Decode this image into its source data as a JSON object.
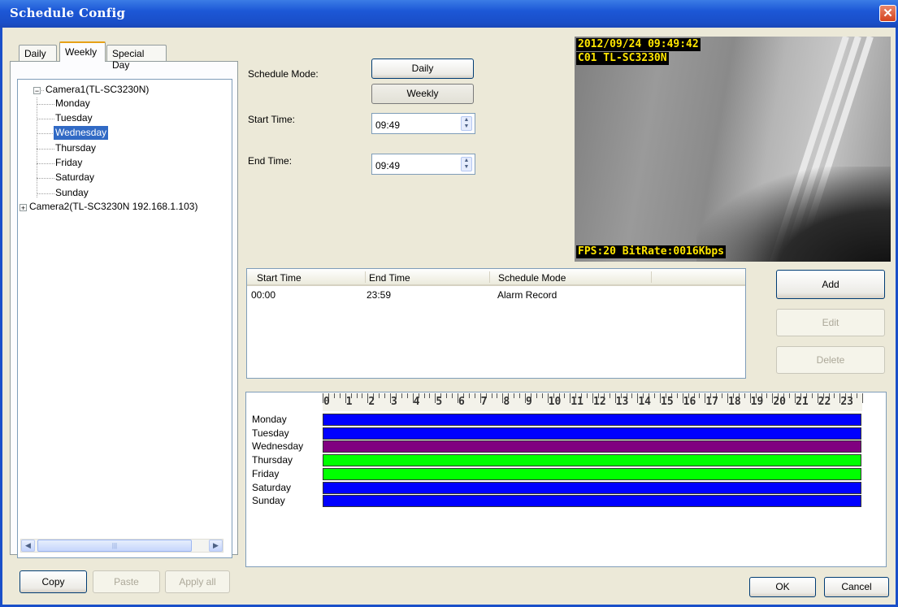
{
  "window": {
    "title": "Schedule Config",
    "close_glyph": "✕"
  },
  "tabs": [
    {
      "label": "Daily"
    },
    {
      "label": "Weekly"
    },
    {
      "label": "Special Day"
    }
  ],
  "tree": {
    "camera1": {
      "label": "Camera1(TL-SC3230N)",
      "expander": "−"
    },
    "days": [
      {
        "label": "Monday"
      },
      {
        "label": "Tuesday"
      },
      {
        "label": "Wednesday"
      },
      {
        "label": "Thursday"
      },
      {
        "label": "Friday"
      },
      {
        "label": "Saturday"
      },
      {
        "label": "Sunday"
      }
    ],
    "camera2": {
      "label": "Camera2(TL-SC3230N 192.168.1.103)",
      "expander": "+"
    },
    "selected": "Wednesday"
  },
  "left_buttons": {
    "copy": "Copy",
    "paste": "Paste",
    "apply_all": "Apply all"
  },
  "form": {
    "schedule_mode_label": "Schedule Mode:",
    "mode_daily": "Daily",
    "mode_weekly": "Weekly",
    "start_time_label": "Start Time:",
    "start_time_value": "09:49",
    "end_time_label": "End Time:",
    "end_time_value": "09:49"
  },
  "video": {
    "timestamp": "2012/09/24 09:49:42",
    "camera": "C01 TL-SC3230N",
    "stats": "FPS:20 BitRate:0016Kbps"
  },
  "list": {
    "columns": [
      "Start Time",
      "End Time",
      "Schedule Mode"
    ],
    "rows": [
      {
        "start": "00:00",
        "end": "23:59",
        "mode": "Alarm Record"
      }
    ]
  },
  "right_buttons": {
    "add": "Add",
    "edit": "Edit",
    "delete": "Delete"
  },
  "timeline": {
    "hours": [
      "0",
      "1",
      "2",
      "3",
      "4",
      "5",
      "6",
      "7",
      "8",
      "9",
      "10",
      "11",
      "12",
      "13",
      "14",
      "15",
      "16",
      "17",
      "18",
      "19",
      "20",
      "21",
      "22",
      "23"
    ],
    "days": [
      {
        "label": "Monday",
        "color": "#0000ff"
      },
      {
        "label": "Tuesday",
        "color": "#0000ff"
      },
      {
        "label": "Wednesday",
        "color": "#800080"
      },
      {
        "label": "Thursday",
        "color": "#00ff00"
      },
      {
        "label": "Friday",
        "color": "#00ff00"
      },
      {
        "label": "Saturday",
        "color": "#0000ff"
      },
      {
        "label": "Sunday",
        "color": "#0000ff"
      }
    ]
  },
  "footer": {
    "ok": "OK",
    "cancel": "Cancel"
  }
}
